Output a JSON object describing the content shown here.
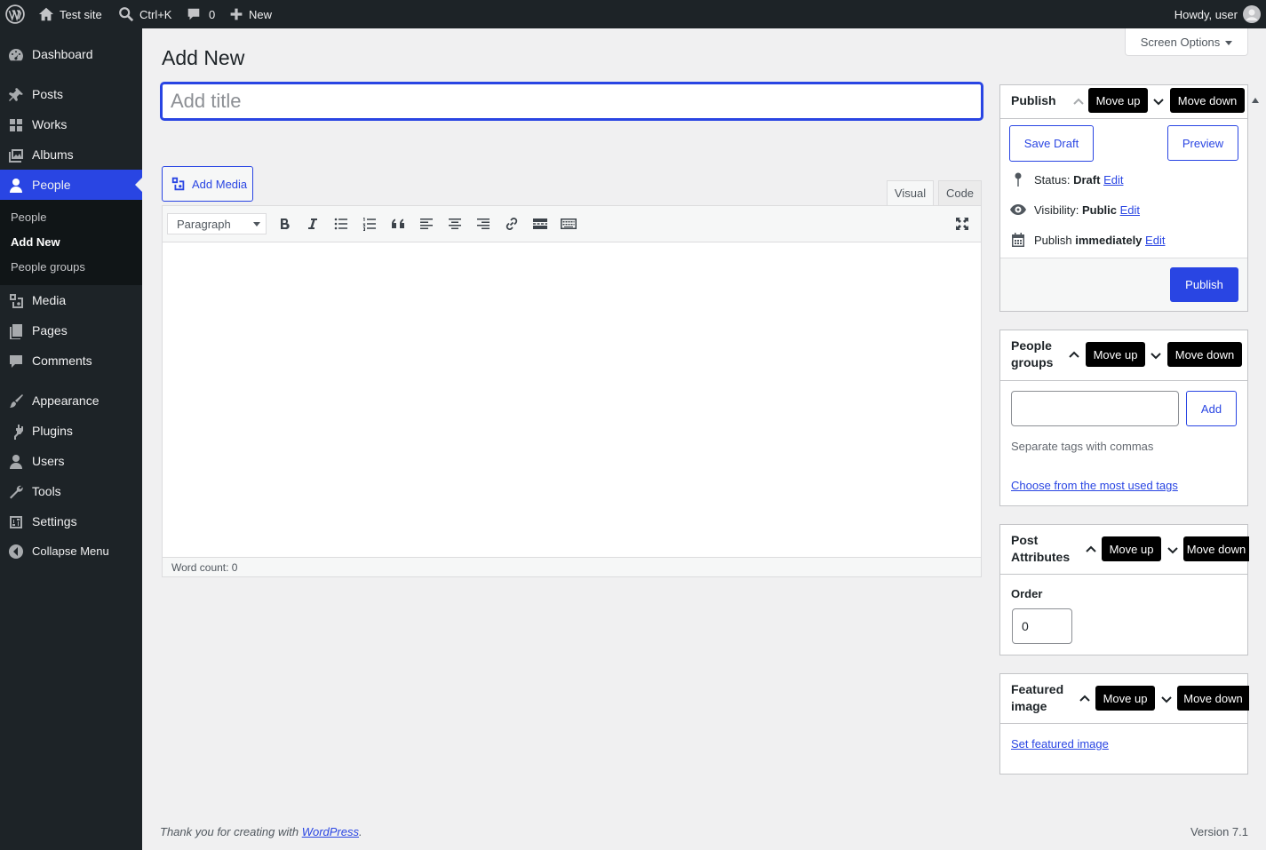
{
  "adminbar": {
    "wp_logo_icon": "wordpress-logo-icon",
    "site_name": "Test site",
    "search_shortcut": "Ctrl+K",
    "comments_count": "0",
    "new_label": "New",
    "greeting": "Howdy, user"
  },
  "sidebar": {
    "items": [
      {
        "label": "Dashboard",
        "icon": "dashboard-icon"
      },
      {
        "label": "Posts",
        "icon": "pin-icon"
      },
      {
        "label": "Works",
        "icon": "grid-icon"
      },
      {
        "label": "Albums",
        "icon": "gallery-icon"
      },
      {
        "label": "People",
        "icon": "person-icon"
      },
      {
        "label": "Media",
        "icon": "media-icon"
      },
      {
        "label": "Pages",
        "icon": "pages-icon"
      },
      {
        "label": "Comments",
        "icon": "comment-icon"
      },
      {
        "label": "Appearance",
        "icon": "brush-icon"
      },
      {
        "label": "Plugins",
        "icon": "plugin-icon"
      },
      {
        "label": "Users",
        "icon": "users-icon"
      },
      {
        "label": "Tools",
        "icon": "wrench-icon"
      },
      {
        "label": "Settings",
        "icon": "settings-icon"
      }
    ],
    "submenu": [
      "People",
      "Add New",
      "People groups"
    ],
    "collapse_label": "Collapse Menu"
  },
  "screen_options": "Screen Options",
  "page_title": "Add New",
  "title_placeholder": "Add title",
  "editor": {
    "add_media": "Add Media",
    "tab_visual": "Visual",
    "tab_code": "Code",
    "format_value": "Paragraph",
    "word_count": "Word count: 0"
  },
  "publish_box": {
    "title": "Publish",
    "move_up": "Move up",
    "move_down": "Move down",
    "save_draft": "Save Draft",
    "preview": "Preview",
    "status_label": "Status:",
    "status_value": "Draft",
    "visibility_label": "Visibility:",
    "visibility_value": "Public",
    "publish_label": "Publish",
    "publish_value": "immediately",
    "edit": "Edit",
    "publish_button": "Publish"
  },
  "groups_box": {
    "title_line1": "People",
    "title_line2": "groups",
    "move_up": "Move up",
    "move_down": "Move down",
    "add_button": "Add",
    "hint": "Separate tags with commas",
    "most_used_link": "Choose from the most used tags"
  },
  "attributes_box": {
    "title_line1": "Post",
    "title_line2": "Attributes",
    "move_up": "Move up",
    "move_down": "Move down",
    "order_label": "Order",
    "order_value": "0"
  },
  "featured_box": {
    "title_line1": "Featured",
    "title_line2": "image",
    "move_up": "Move up",
    "move_down": "Move down",
    "set_link": "Set featured image"
  },
  "footer": {
    "thanks_prefix": "Thank you for creating with ",
    "wp_link": "WordPress",
    "thanks_suffix": ".",
    "version": "Version 7.1"
  },
  "colors": {
    "accent": "#2945e3",
    "adminbar_bg": "#1d2327",
    "sidebar_bg": "#1d2327",
    "page_bg": "#f0f0f1"
  }
}
